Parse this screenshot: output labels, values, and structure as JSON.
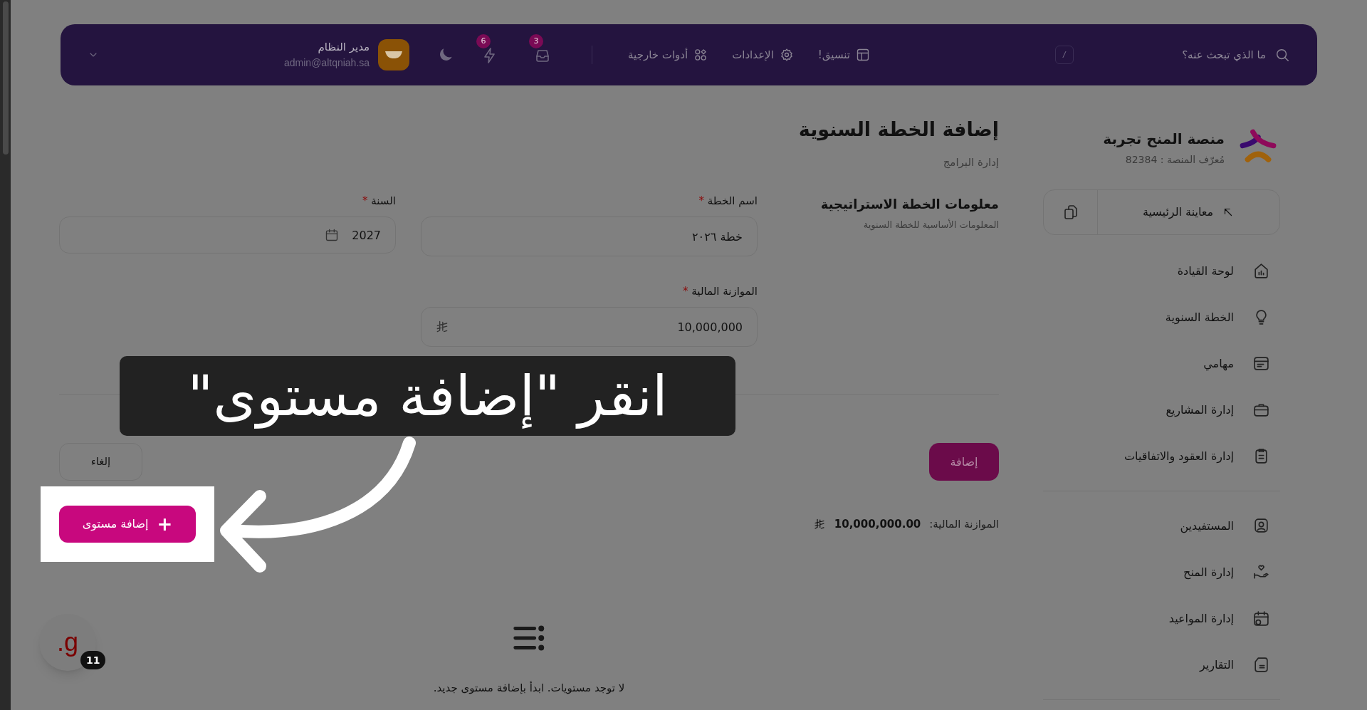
{
  "navbar": {
    "search": {
      "placeholder": "ما الذي تبحث عنه؟",
      "shortcut": "/"
    },
    "links": [
      {
        "label": "تنسيق!"
      },
      {
        "label": "الإعدادات"
      },
      {
        "label": "أدوات خارجية"
      }
    ],
    "notifications": [
      {
        "count": "3"
      },
      {
        "count": "6"
      }
    ],
    "user": {
      "name": "مدير النظام",
      "email": "admin@altqniah.sa"
    }
  },
  "sidebar": {
    "brand": {
      "title": "منصة المنح تجربة",
      "subtitle": "مُعرّف المنصة : 82384"
    },
    "preview_button": "معاينة الرئيسية",
    "groups": [
      [
        {
          "label": "لوحة القيادة"
        },
        {
          "label": "الخطة السنوية"
        },
        {
          "label": "مهامي"
        },
        {
          "label": "إدارة المشاريع"
        },
        {
          "label": "إدارة العقود والاتفاقيات"
        }
      ],
      [
        {
          "label": "المستفيدين"
        },
        {
          "label": "إدارة المنح"
        },
        {
          "label": "إدارة المواعيد"
        },
        {
          "label": "التقارير"
        }
      ]
    ]
  },
  "page": {
    "title": "إضافة الخطة السنوية",
    "breadcrumb": "إدارة البرامج"
  },
  "section": {
    "title": "معلومات الخطة الاستراتيجية",
    "description": "المعلومات الأساسية للخطة السنوية"
  },
  "fields": [
    {
      "label": "اسم الخطة",
      "required_mark": "*",
      "value": "خطة ٢٠٢٦"
    },
    {
      "label": "السنة",
      "required_mark": "*",
      "value": "2027"
    },
    {
      "label": "الموازنة المالية",
      "required_mark": "*",
      "value": "10,000,000"
    }
  ],
  "actions": {
    "submit": "إضافة",
    "cancel": "إلغاء"
  },
  "summary": {
    "label": "الموازنة المالية:",
    "value": "10,000,000.00"
  },
  "add_level_button": {
    "icon": "+",
    "label": "إضافة مستوى"
  },
  "empty_state": "لا توجد مستويات. ابدأ بإضافة مستوى جديد.",
  "tutorial": {
    "caption": "انقر \"إضافة مستوى\""
  },
  "assistant_badge": {
    "letter": "g.",
    "count": "11"
  }
}
